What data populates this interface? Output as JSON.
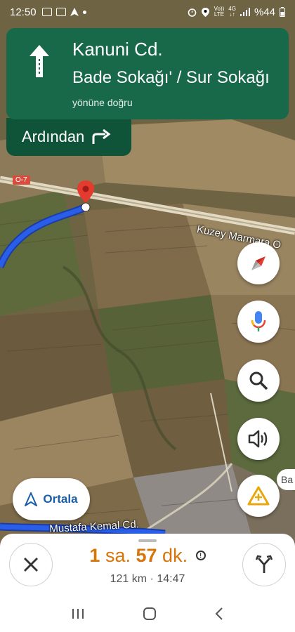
{
  "status_bar": {
    "time": "12:50",
    "network_top": "Vo))",
    "network_bottom": "LTE",
    "data_top": "4G",
    "data_bottom": "↓↑",
    "battery": "%44"
  },
  "banner": {
    "street": "Kanuni Cd.",
    "towards": "Bade Sokağı' / Sur Sokağı",
    "towards_suffix": "yönüne doğru",
    "direction_icon": "straight-arrow-icon",
    "background_color": "#18684a"
  },
  "then": {
    "label": "Ardından",
    "icon": "turn-right-icon"
  },
  "map": {
    "route_shield": "O-7",
    "road_label_1": "Kuzey Marmara O",
    "road_label_2": "Mustafa Kemal Cd.",
    "partial_label": "Ba",
    "route_color": "#2a5ee8"
  },
  "controls": {
    "compass_icon": "compass-icon",
    "voice_icon": "microphone-icon",
    "search_icon": "search-icon",
    "sound_icon": "speaker-icon",
    "report_icon": "add-report-icon",
    "recenter_label": "Ortala"
  },
  "trip": {
    "eta_hours": "1",
    "eta_hours_unit": "sa.",
    "eta_minutes": "57",
    "eta_minutes_unit": "dk.",
    "distance": "121 km",
    "separator": "·",
    "arrival": "14:47",
    "accent_color": "#d6750a"
  },
  "system_nav": {
    "recents_icon": "recents-icon",
    "home_icon": "home-icon",
    "back_icon": "back-icon"
  }
}
